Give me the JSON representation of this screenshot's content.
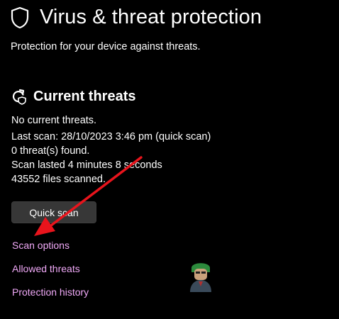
{
  "page": {
    "title": "Virus & threat protection",
    "subtitle": "Protection for your device against threats."
  },
  "current_threats": {
    "title": "Current threats",
    "status": "No current threats.",
    "last_scan": "Last scan: 28/10/2023 3:46 pm (quick scan)",
    "threats_found": "0 threat(s) found.",
    "scan_duration": "Scan lasted 4 minutes 8 seconds",
    "files_scanned": "43552 files scanned."
  },
  "actions": {
    "quick_scan_label": "Quick scan"
  },
  "links": {
    "scan_options": "Scan options",
    "allowed_threats": "Allowed threats",
    "protection_history": "Protection history"
  },
  "icons": {
    "header": "shield-icon",
    "section": "refresh-shield-icon",
    "annotation": "red-arrow-annotation",
    "watermark": "appuals-mascot-logo"
  },
  "colors": {
    "background": "#000000",
    "text": "#ffffff",
    "link": "#f0a9f7",
    "button": "#373737",
    "arrow": "#e8141c"
  }
}
